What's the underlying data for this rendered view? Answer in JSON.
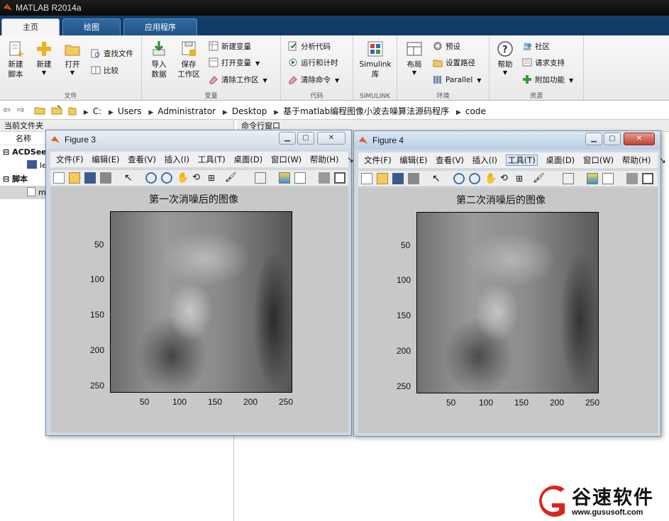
{
  "app": {
    "title": "MATLAB R2014a"
  },
  "tabs": [
    {
      "label": "主页"
    },
    {
      "label": "绘图"
    },
    {
      "label": "应用程序"
    }
  ],
  "ribbon": {
    "file_group": {
      "label": "文件",
      "new_script": "新建\n脚本",
      "new": "新建",
      "open": "打开",
      "find_files": "查找文件",
      "compare": "比较"
    },
    "variable_group": {
      "label": "变量",
      "import_data": "导入\n数据",
      "save_workspace": "保存\n工作区",
      "new_variable": "新建变量",
      "open_variable": "打开变量",
      "clear_workspace": "清除工作区"
    },
    "code_group": {
      "label": "代码",
      "analyze_code": "分析代码",
      "run_and_time": "运行和计时",
      "clear_commands": "清除命令"
    },
    "simulink_group": {
      "label": "SIMULINK",
      "simulink_library": "Simulink\n库"
    },
    "environment_group": {
      "label": "环境",
      "layout": "布局",
      "preferences": "预设",
      "set_path": "设置路径",
      "parallel": "Parallel"
    },
    "resources_group": {
      "label": "资源",
      "help": "帮助",
      "community": "社区",
      "request_support": "请求支持",
      "addons": "附加功能"
    }
  },
  "address": {
    "crumbs": [
      "C:",
      "Users",
      "Administrator",
      "Desktop",
      "基于matlab编程图像小波去噪算法源码程序",
      "code"
    ]
  },
  "left_panel": {
    "title": "当前文件夹",
    "name_col": "名称",
    "groups": [
      {
        "label": "ACDSee",
        "file": "le"
      },
      {
        "label": "脚本",
        "file": "m"
      }
    ]
  },
  "command_window": {
    "title": "命令行窗口"
  },
  "figures": [
    {
      "name": "Figure 3",
      "menu": [
        "文件(F)",
        "编辑(E)",
        "查看(V)",
        "插入(I)",
        "工具(T)",
        "桌面(D)",
        "窗口(W)",
        "帮助(H)"
      ],
      "axes_title": "第一次消噪后的图像"
    },
    {
      "name": "Figure 4",
      "menu": [
        "文件(F)",
        "编辑(E)",
        "查看(V)",
        "插入(I)",
        "工具(T)",
        "桌面(D)",
        "窗口(W)",
        "帮助(H)"
      ],
      "axes_title": "第二次消噪后的图像"
    }
  ],
  "axes_ticks": {
    "x": [
      "50",
      "100",
      "150",
      "200",
      "250"
    ],
    "y": [
      "50",
      "100",
      "150",
      "200",
      "250"
    ]
  },
  "watermark": {
    "name": "谷速软件",
    "url": "www.gususoft.com"
  },
  "colors": {
    "tab_bar": "#123e6b",
    "logo_red": "#d9261c"
  }
}
